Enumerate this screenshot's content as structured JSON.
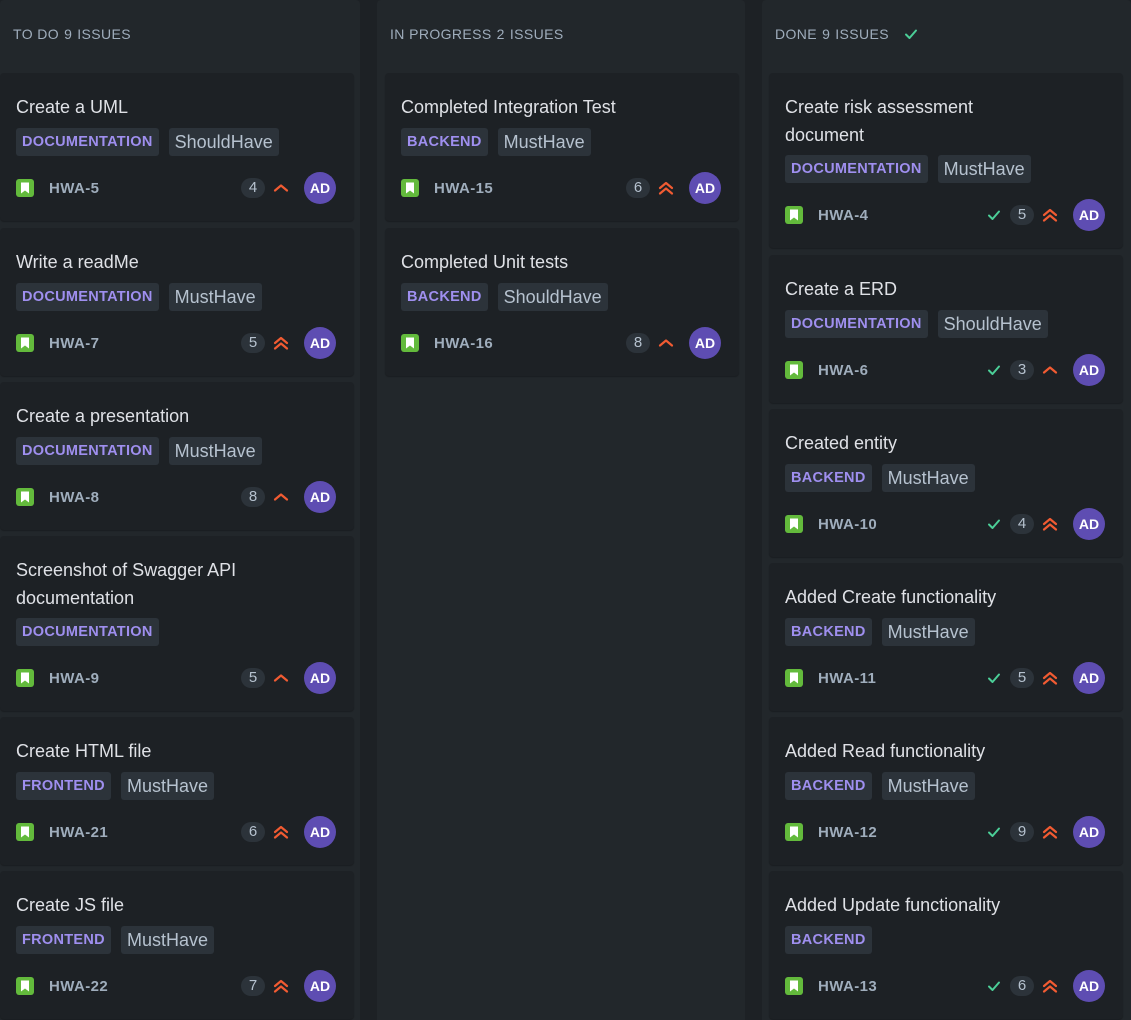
{
  "columns": [
    {
      "name": "TO DO",
      "count": "9",
      "issues_label": "ISSUES",
      "done": false,
      "cards": [
        {
          "title_lines": [
            "Create a UML"
          ],
          "category": "DOCUMENTATION",
          "priority_label": "ShouldHave",
          "key": "HWA-5",
          "points": "4",
          "priority": "medium",
          "assignee": "AD",
          "done": false
        },
        {
          "title_lines": [
            "Write a readMe"
          ],
          "category": "DOCUMENTATION",
          "priority_label": "MustHave",
          "key": "HWA-7",
          "points": "5",
          "priority": "high",
          "assignee": "AD",
          "done": false
        },
        {
          "title_lines": [
            "Create a presentation"
          ],
          "category": "DOCUMENTATION",
          "priority_label": "MustHave",
          "key": "HWA-8",
          "points": "8",
          "priority": "medium",
          "assignee": "AD",
          "done": false
        },
        {
          "title_lines": [
            "Screenshot of Swagger API",
            "documentation"
          ],
          "category": "DOCUMENTATION",
          "priority_label": "",
          "key": "HWA-9",
          "points": "5",
          "priority": "medium",
          "assignee": "AD",
          "done": false
        },
        {
          "title_lines": [
            "Create HTML file"
          ],
          "category": "FRONTEND",
          "priority_label": "MustHave",
          "key": "HWA-21",
          "points": "6",
          "priority": "high",
          "assignee": "AD",
          "done": false
        },
        {
          "title_lines": [
            "Create JS file"
          ],
          "category": "FRONTEND",
          "priority_label": "MustHave",
          "key": "HWA-22",
          "points": "7",
          "priority": "high",
          "assignee": "AD",
          "done": false
        }
      ]
    },
    {
      "name": "IN PROGRESS",
      "count": "2",
      "issues_label": "ISSUES",
      "done": false,
      "cards": [
        {
          "title_lines": [
            "Completed Integration Test"
          ],
          "category": "BACKEND",
          "priority_label": "MustHave",
          "key": "HWA-15",
          "points": "6",
          "priority": "high",
          "assignee": "AD",
          "done": false
        },
        {
          "title_lines": [
            "Completed Unit tests"
          ],
          "category": "BACKEND",
          "priority_label": "ShouldHave",
          "key": "HWA-16",
          "points": "8",
          "priority": "medium",
          "assignee": "AD",
          "done": false
        }
      ]
    },
    {
      "name": "DONE",
      "count": "9",
      "issues_label": "ISSUES",
      "done": true,
      "cards": [
        {
          "title_lines": [
            "Create risk assessment",
            "document"
          ],
          "category": "DOCUMENTATION",
          "priority_label": "MustHave",
          "key": "HWA-4",
          "points": "5",
          "priority": "high",
          "assignee": "AD",
          "done": true
        },
        {
          "title_lines": [
            "Create a ERD"
          ],
          "category": "DOCUMENTATION",
          "priority_label": "ShouldHave",
          "key": "HWA-6",
          "points": "3",
          "priority": "medium",
          "assignee": "AD",
          "done": true
        },
        {
          "title_lines": [
            "Created entity"
          ],
          "category": "BACKEND",
          "priority_label": "MustHave",
          "key": "HWA-10",
          "points": "4",
          "priority": "high",
          "assignee": "AD",
          "done": true
        },
        {
          "title_lines": [
            "Added Create functionality"
          ],
          "category": "BACKEND",
          "priority_label": "MustHave",
          "key": "HWA-11",
          "points": "5",
          "priority": "high",
          "assignee": "AD",
          "done": true
        },
        {
          "title_lines": [
            "Added Read functionality"
          ],
          "category": "BACKEND",
          "priority_label": "MustHave",
          "key": "HWA-12",
          "points": "9",
          "priority": "high",
          "assignee": "AD",
          "done": true
        },
        {
          "title_lines": [
            "Added Update functionality"
          ],
          "category": "BACKEND",
          "priority_label": "",
          "key": "HWA-13",
          "points": "6",
          "priority": "high",
          "assignee": "AD",
          "done": true
        }
      ]
    }
  ],
  "colors": {
    "priority_icon": "#f15b32",
    "story_icon": "#63ba3c",
    "done_check": "#4bce97",
    "avatar": "#5e4db2",
    "category_text": "#9f8fef"
  }
}
